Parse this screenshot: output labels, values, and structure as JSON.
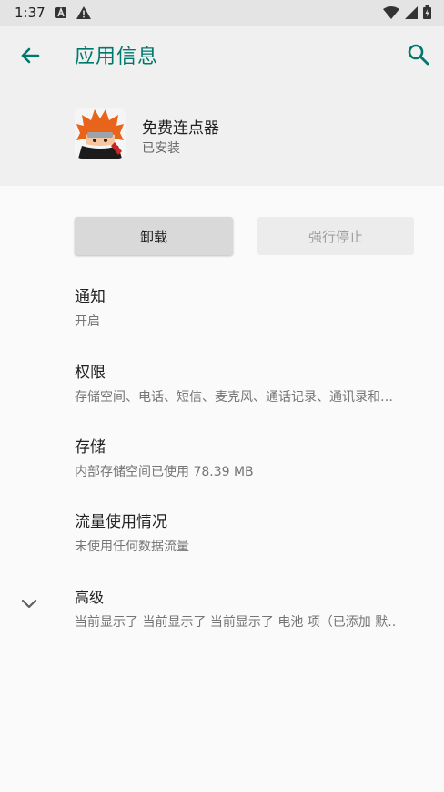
{
  "status_bar": {
    "time": "1:37",
    "icons": [
      "notification-a-icon",
      "warning-icon",
      "wifi-icon",
      "signal-icon",
      "battery-icon"
    ]
  },
  "header": {
    "title": "应用信息",
    "app_name": "免费连点器",
    "app_status": "已安装"
  },
  "buttons": {
    "uninstall": "卸载",
    "force_stop": "强行停止"
  },
  "items": [
    {
      "title": "通知",
      "subtitle": "开启"
    },
    {
      "title": "权限",
      "subtitle": "存储空间、电话、短信、麦克风、通话记录、通讯录和…"
    },
    {
      "title": "存储",
      "subtitle": "内部存储空间已使用 78.39 MB"
    },
    {
      "title": "流量使用情况",
      "subtitle": "未使用任何数据流量"
    },
    {
      "title": "高级",
      "subtitle": "当前显示了 当前显示了 当前显示了 电池 项（已添加 默.."
    }
  ],
  "colors": {
    "accent": "#00796b",
    "header_bg": "#f0f0f0",
    "page_bg": "#fafafa"
  }
}
